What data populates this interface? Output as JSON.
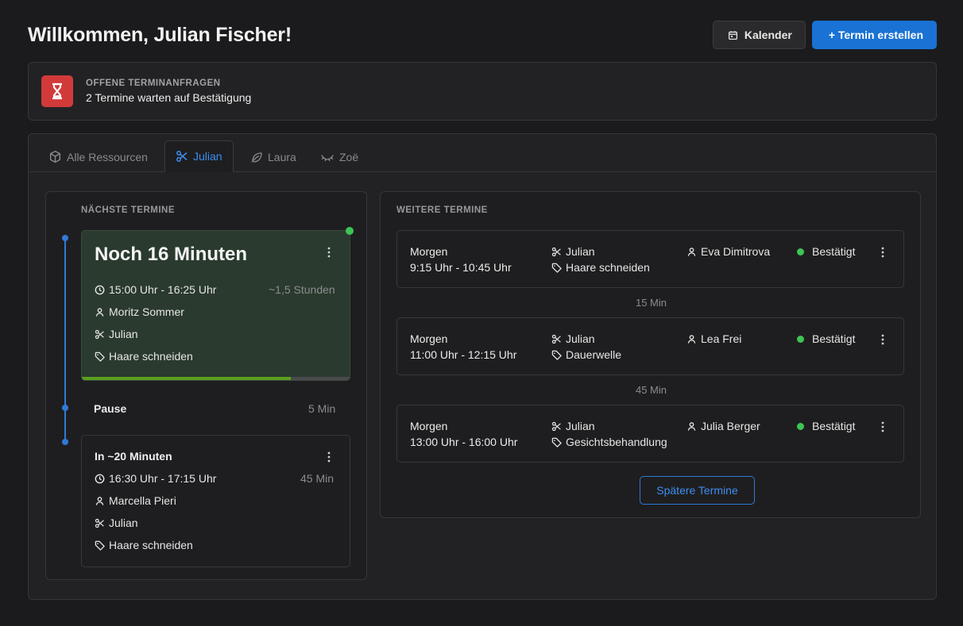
{
  "header": {
    "title": "Willkommen, Julian Fischer!",
    "calendar_label": "Kalender",
    "create_label": "+ Termin erstellen"
  },
  "alert": {
    "label": "OFFENE TERMINANFRAGEN",
    "message": "2 Termine warten auf Bestätigung"
  },
  "tabs": [
    {
      "label": "Alle Ressourcen",
      "icon": "cube-icon",
      "active": false
    },
    {
      "label": "Julian",
      "icon": "scissors-icon",
      "active": true
    },
    {
      "label": "Laura",
      "icon": "leaf-icon",
      "active": false
    },
    {
      "label": "Zoë",
      "icon": "eyelash-icon",
      "active": false
    }
  ],
  "next": {
    "section_label": "NÄCHSTE TERMINE",
    "current": {
      "title": "Noch 16 Minuten",
      "time": "15:00 Uhr - 16:25 Uhr",
      "duration": "~1,5 Stunden",
      "client": "Moritz Sommer",
      "resource": "Julian",
      "service": "Haare schneiden",
      "progress": 0.78
    },
    "pause": {
      "label": "Pause",
      "duration": "5 Min"
    },
    "upcoming": {
      "title": "In ~20 Minuten",
      "time": "16:30 Uhr - 17:15 Uhr",
      "duration": "45 Min",
      "client": "Marcella Pieri",
      "resource": "Julian",
      "service": "Haare schneiden"
    }
  },
  "more": {
    "section_label": "WEITERE TERMINE",
    "appointments": [
      {
        "day": "Morgen",
        "time": "9:15 Uhr - 10:45 Uhr",
        "resource": "Julian",
        "service": "Haare schneiden",
        "client": "Eva Dimitrova",
        "status": "Bestätigt"
      },
      {
        "day": "Morgen",
        "time": "11:00 Uhr - 12:15 Uhr",
        "resource": "Julian",
        "service": "Dauerwelle",
        "client": "Lea Frei",
        "status": "Bestätigt"
      },
      {
        "day": "Morgen",
        "time": "13:00 Uhr - 16:00 Uhr",
        "resource": "Julian",
        "service": "Gesichtsbehandlung",
        "client": "Julia Berger",
        "status": "Bestätigt"
      }
    ],
    "gaps": [
      "15 Min",
      "45 Min"
    ],
    "later_label": "Spätere Termine"
  },
  "colors": {
    "accent": "#1a72d4",
    "alert_red": "#d23a3a",
    "status_green": "#3ec455",
    "progress_green": "#5aa020"
  }
}
